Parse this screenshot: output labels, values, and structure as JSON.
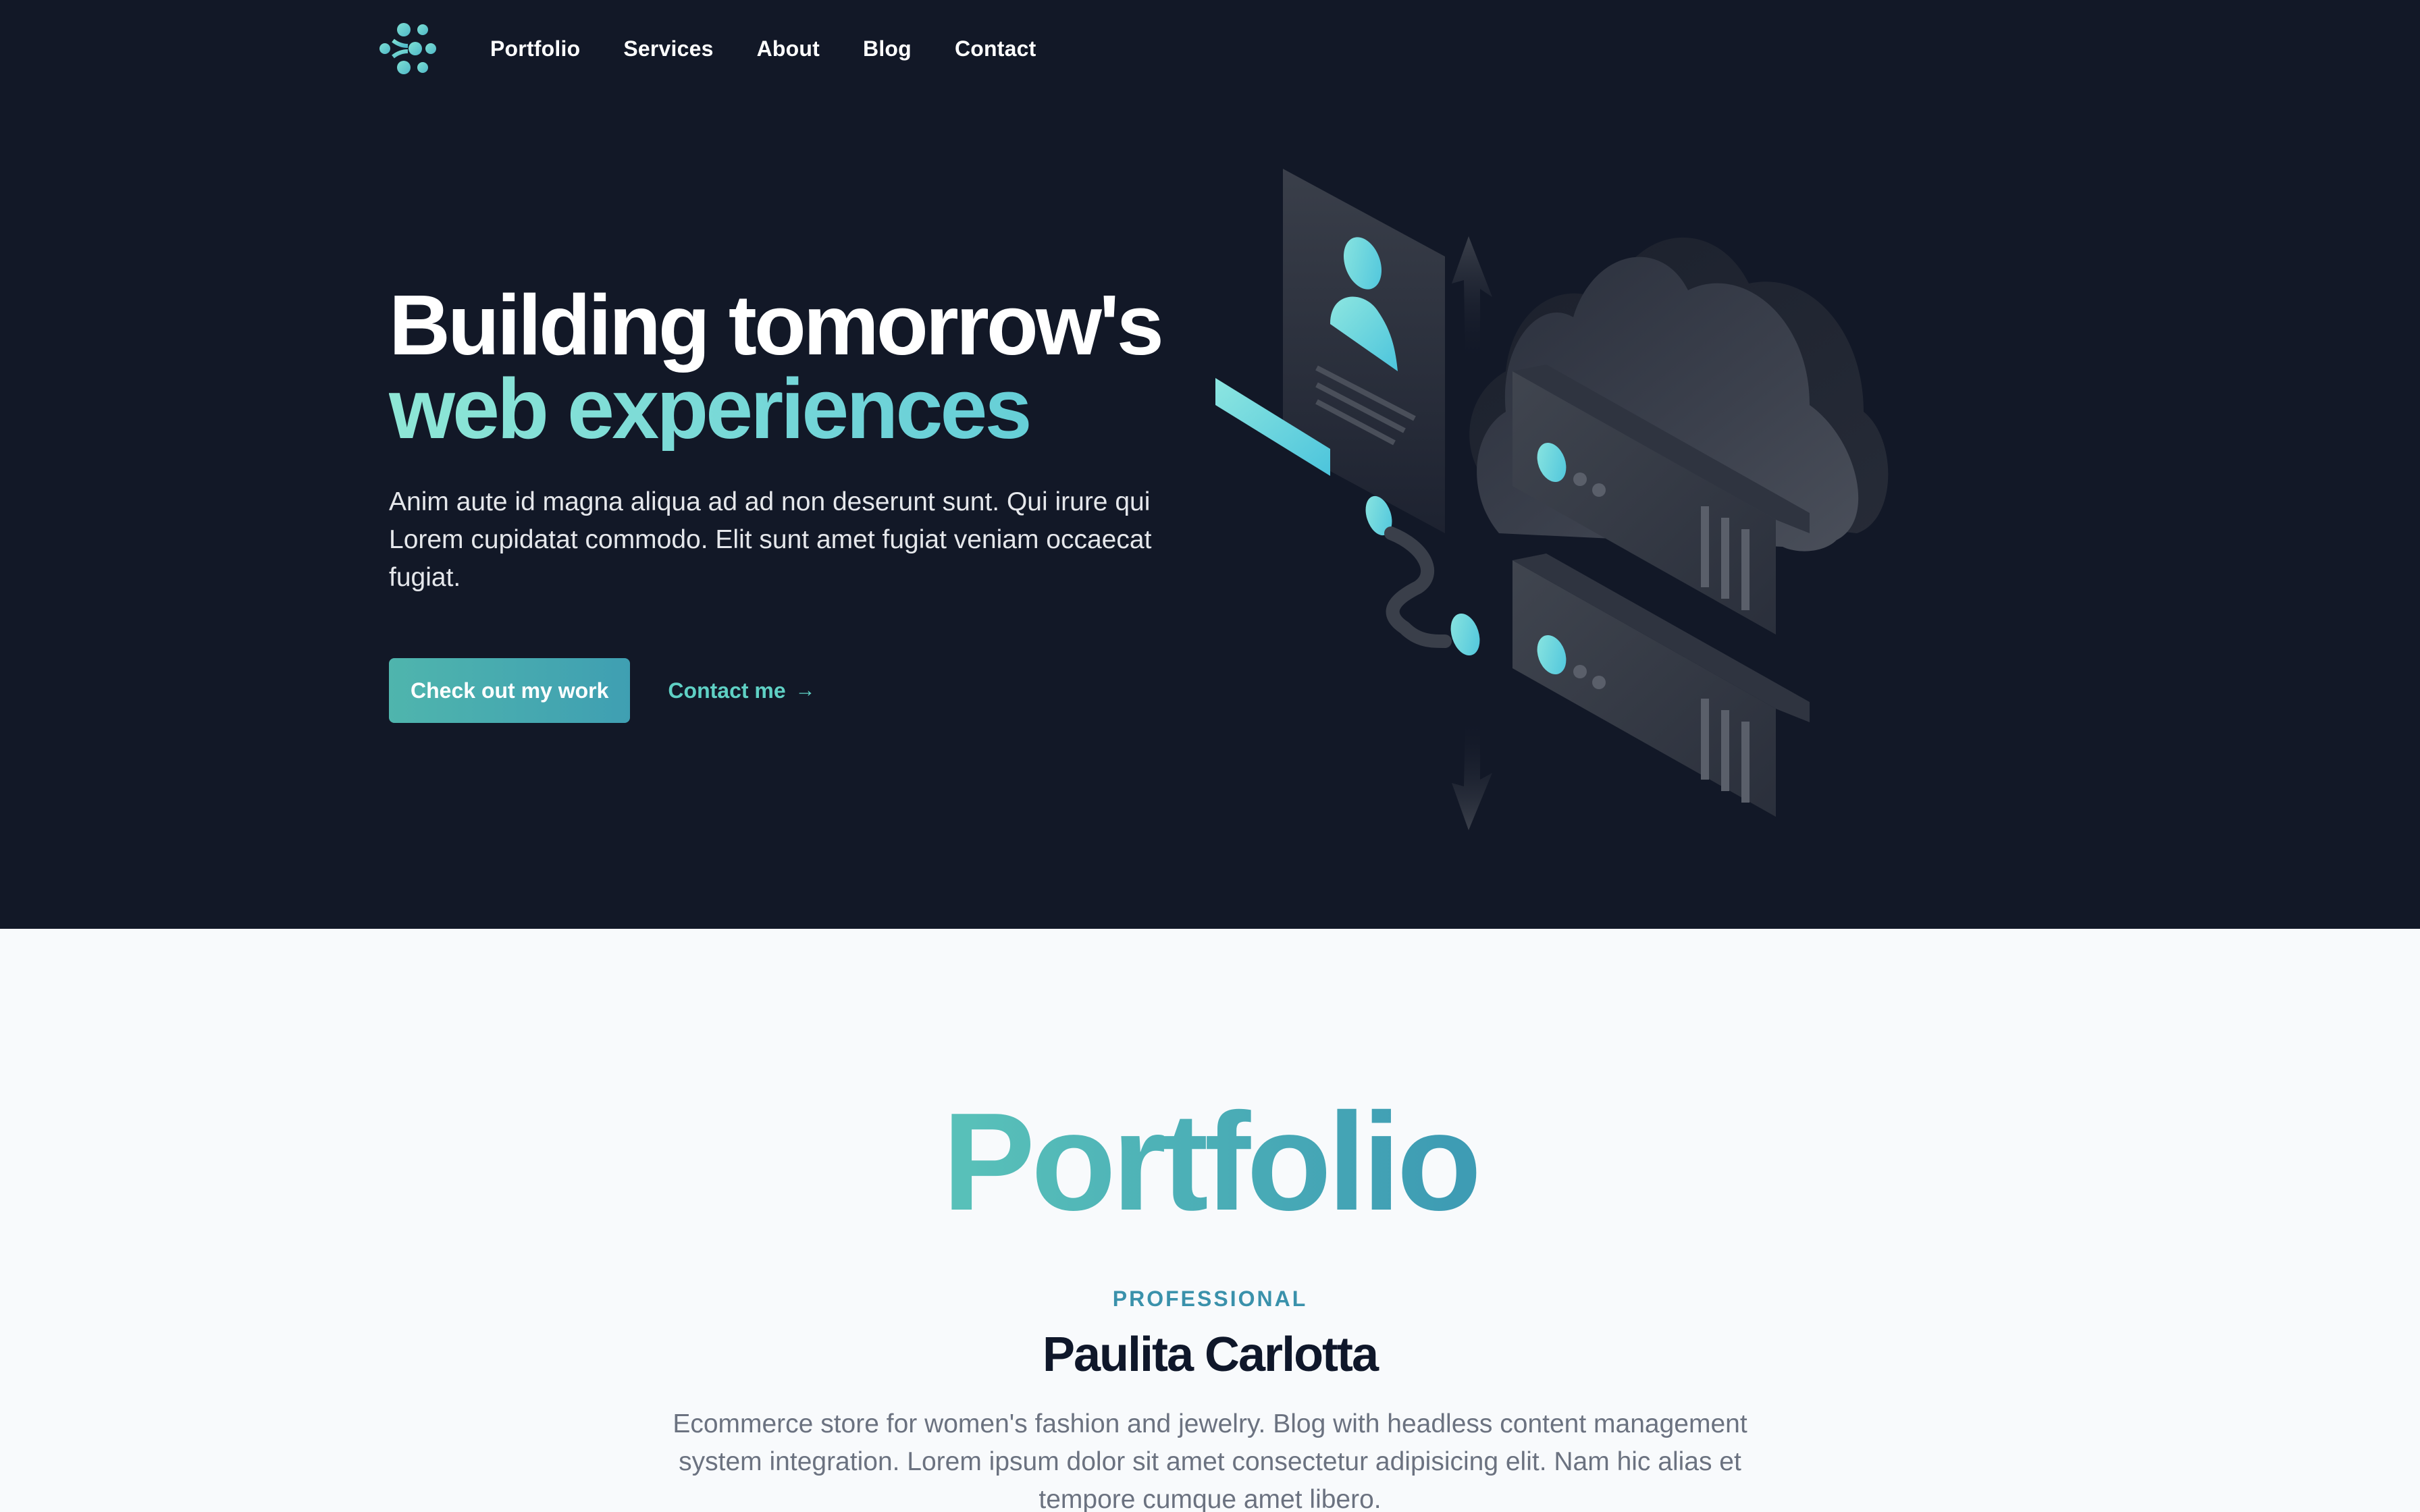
{
  "nav": {
    "logo_icon": "dots-chevron-logo-icon",
    "items": [
      {
        "label": "Portfolio"
      },
      {
        "label": "Services"
      },
      {
        "label": "About"
      },
      {
        "label": "Blog"
      },
      {
        "label": "Contact"
      }
    ]
  },
  "hero": {
    "headline_line1": "Building tomorrow's",
    "headline_line2": "web experiences",
    "description": "Anim aute id magna aliqua ad ad non deserunt sunt. Qui irure qui Lorem cupidatat commodo. Elit sunt amet fugiat veniam occaecat fugiat.",
    "primary_button": "Check out my work",
    "secondary_link": "Contact me",
    "secondary_arrow": "→",
    "illustration": "isometric-cloud-servers-illustration"
  },
  "portfolio": {
    "title": "Portfolio",
    "eyebrow": "PROFESSIONAL",
    "name": "Paulita Carlotta",
    "description": "Ecommerce store for women's fashion and jewelry. Blog with headless content management system integration. Lorem ipsum dolor sit amet consectetur adipisicing elit. Nam hic alias et tempore cumque amet libero."
  },
  "colors": {
    "hero_bg": "#121827",
    "accent_teal": "#5fd0c4",
    "accent_blue": "#3a91ab",
    "page_bg": "#f8fafc"
  }
}
